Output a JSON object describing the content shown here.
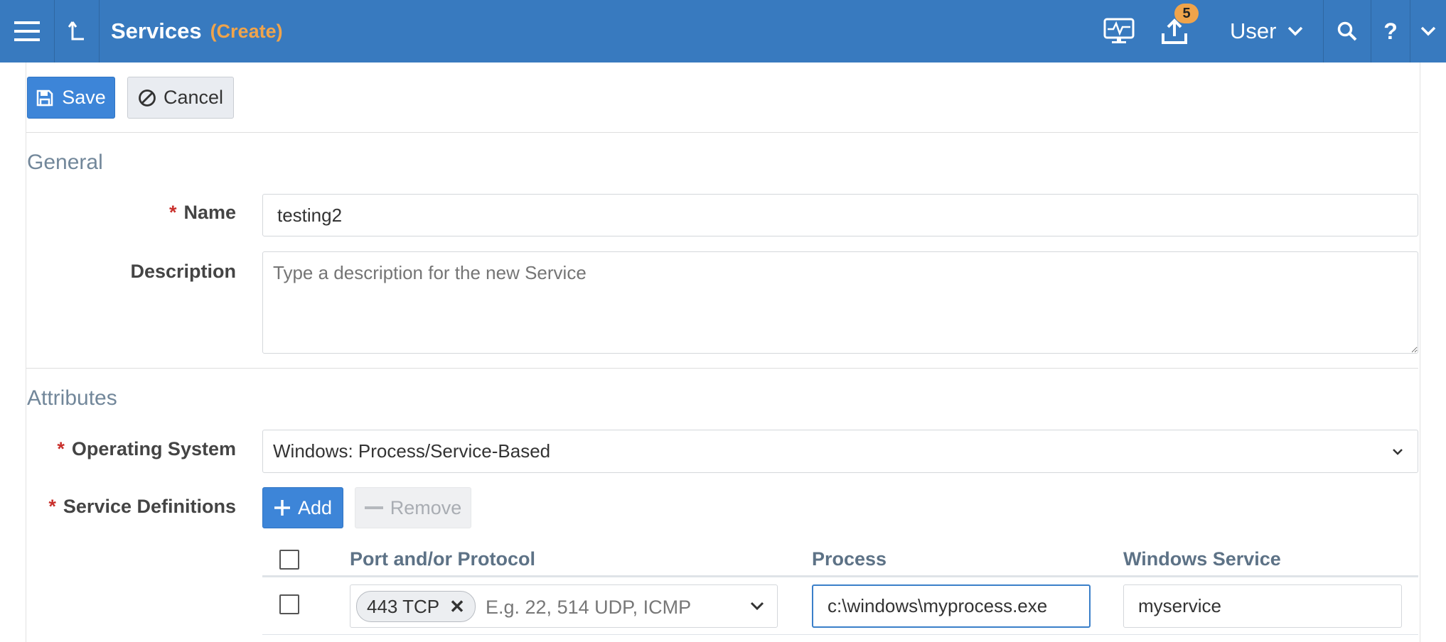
{
  "topbar": {
    "title": "Services",
    "mode": "(Create)",
    "upload_badge_count": "5",
    "user_label": "User",
    "help_label": "?"
  },
  "toolbar": {
    "save_label": "Save",
    "cancel_label": "Cancel"
  },
  "general": {
    "section_title": "General",
    "name_label": "Name",
    "name_value": "testing2",
    "description_label": "Description",
    "description_placeholder": "Type a description for the new Service"
  },
  "attributes": {
    "section_title": "Attributes",
    "os_label": "Operating System",
    "os_value": "Windows: Process/Service-Based",
    "service_definitions_label": "Service Definitions",
    "add_label": "Add",
    "remove_label": "Remove",
    "table": {
      "columns": [
        "Port and/or Protocol",
        "Process",
        "Windows Service"
      ],
      "rows": [
        {
          "port_tag": "443 TCP",
          "port_placeholder": "E.g. 22, 514 UDP, ICMP",
          "process": "c:\\windows\\myprocess.exe",
          "windows_service": "myservice"
        }
      ]
    }
  },
  "colors": {
    "topbar": "#387abf",
    "accent": "#3d85d8",
    "mode_text": "#f0a44b",
    "required": "#c9302c"
  }
}
